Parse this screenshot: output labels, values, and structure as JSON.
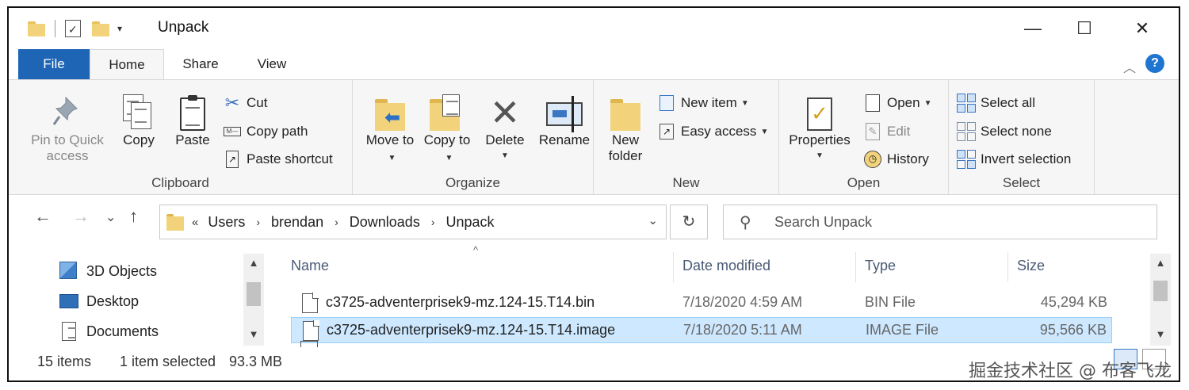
{
  "window": {
    "title": "Unpack",
    "minimize": "—",
    "maximize": "☐",
    "close": "✕",
    "qat_dropdown": "▾"
  },
  "ribbon_tabs": {
    "file": "File",
    "home": "Home",
    "share": "Share",
    "view": "View",
    "collapse_icon": "chevron-up-icon",
    "collapse_glyph": "︿",
    "help": "?"
  },
  "clipboard": {
    "pin_label": "Pin to Quick access",
    "copy_label": "Copy",
    "paste_label": "Paste",
    "cut_label": "Cut",
    "copy_path_label": "Copy path",
    "paste_shortcut_label": "Paste shortcut",
    "group_label": "Clipboard"
  },
  "organize": {
    "move_to_label": "Move to",
    "copy_to_label": "Copy to",
    "delete_label": "Delete",
    "rename_label": "Rename",
    "group_label": "Organize"
  },
  "new_group": {
    "new_folder_label": "New folder",
    "new_item_label": "New item",
    "easy_access_label": "Easy access",
    "group_label": "New"
  },
  "open_group": {
    "properties_label": "Properties",
    "open_label": "Open",
    "edit_label": "Edit",
    "history_label": "History",
    "group_label": "Open"
  },
  "select_group": {
    "select_all_label": "Select all",
    "select_none_label": "Select none",
    "invert_selection_label": "Invert selection",
    "group_label": "Select"
  },
  "navigation": {
    "back": "←",
    "forward": "→",
    "recent": "⌄",
    "up": "↑",
    "lead": "«",
    "breadcrumbs": [
      "Users",
      "brendan",
      "Downloads",
      "Unpack"
    ],
    "crumb_sep": "›",
    "address_dropdown": "⌄",
    "refresh": "↻",
    "search_placeholder": "Search Unpack",
    "search_glyph": "⚲"
  },
  "nav_pane": {
    "items": [
      {
        "label": "3D Objects",
        "icon": "cube-icon"
      },
      {
        "label": "Desktop",
        "icon": "desktop-icon"
      },
      {
        "label": "Documents",
        "icon": "documents-icon"
      }
    ],
    "scroll_up": "▲",
    "scroll_down": "▼"
  },
  "file_list": {
    "columns": {
      "name": "Name",
      "date": "Date modified",
      "type": "Type",
      "size": "Size"
    },
    "sort_indicator": "^",
    "rows": [
      {
        "name": "c3725-adventerprisek9-mz.124-15.T14.bin",
        "date": "7/18/2020 4:59 AM",
        "type": "BIN File",
        "size": "45,294 KB",
        "selected": false
      },
      {
        "name": "c3725-adventerprisek9-mz.124-15.T14.image",
        "date": "7/18/2020 5:11 AM",
        "type": "IMAGE File",
        "size": "95,566 KB",
        "selected": true
      }
    ],
    "scroll_up": "▲",
    "scroll_down": "▼"
  },
  "status": {
    "item_count": "15 items",
    "selection": "1 item selected",
    "selection_size": "93.3 MB"
  },
  "watermark": "掘金技术社区 @ 布客飞龙",
  "colors": {
    "file_tab": "#1f65b5",
    "selected_row": "#cde8ff",
    "folder": "#f2d37c",
    "help": "#1f75d0"
  }
}
